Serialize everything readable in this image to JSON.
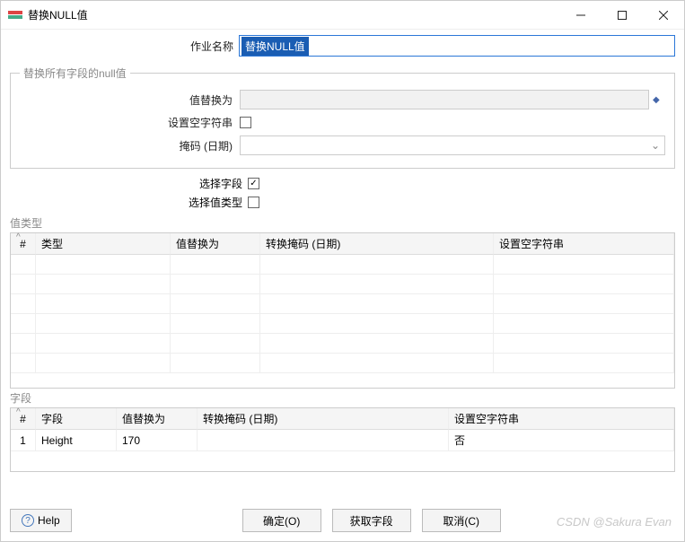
{
  "window": {
    "title": "替换NULL值"
  },
  "form": {
    "job_name_label": "作业名称",
    "job_name_value": "替换NULL值"
  },
  "group_all_fields": {
    "legend": "替换所有字段的null值",
    "replace_label": "值替换为",
    "replace_value": "",
    "set_empty_label": "设置空字符串",
    "set_empty_checked": false,
    "mask_label": "掩码 (日期)",
    "mask_value": ""
  },
  "options": {
    "select_field_label": "选择字段",
    "select_field_checked": true,
    "select_type_label": "选择值类型",
    "select_type_checked": false
  },
  "type_table": {
    "title": "值类型",
    "headers": {
      "idx": "#",
      "type": "类型",
      "replace": "值替换为",
      "mask": "转换掩码 (日期)",
      "empty": "设置空字符串"
    },
    "rows": []
  },
  "field_table": {
    "title": "字段",
    "headers": {
      "idx": "#",
      "field": "字段",
      "replace": "值替换为",
      "mask": "转换掩码 (日期)",
      "empty": "设置空字符串"
    },
    "rows": [
      {
        "idx": "1",
        "field": "Height",
        "replace": "170",
        "mask": "",
        "empty": "否"
      }
    ]
  },
  "buttons": {
    "help": "Help",
    "ok": "确定(O)",
    "get_fields": "获取字段",
    "cancel": "取消(C)"
  },
  "watermark": "CSDN @Sakura Evan"
}
